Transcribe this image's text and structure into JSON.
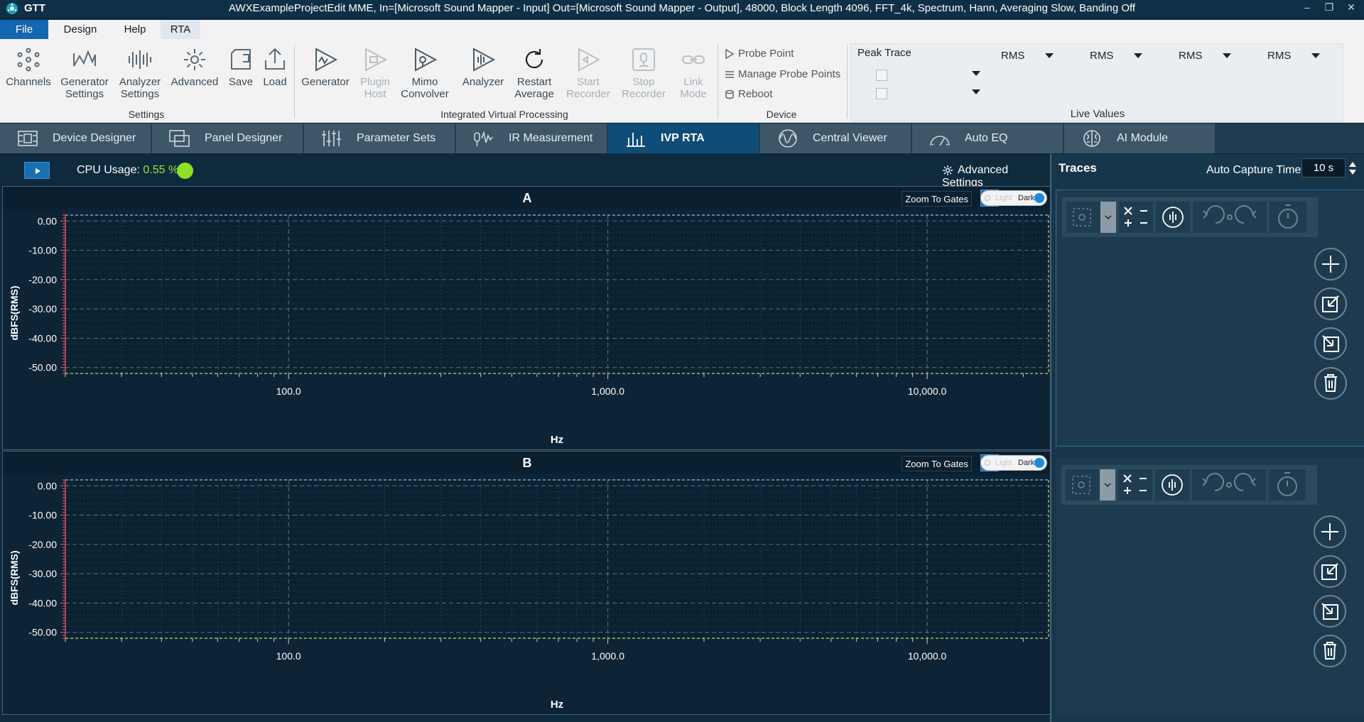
{
  "app": {
    "name": "GTT",
    "window_title": "AWXExampleProjectEdit MME, In=[Microsoft Sound Mapper - Input] Out=[Microsoft Sound Mapper - Output], 48000, Block Length 4096, FFT_4k, Spectrum, Hann, Averaging Slow, Banding Off",
    "controls": [
      "–",
      "❐",
      "✕"
    ]
  },
  "menu": [
    "File",
    "Design",
    "Help",
    "RTA"
  ],
  "ribbon": {
    "settings_group": {
      "label": "Settings",
      "buttons": [
        "Channels",
        "Generator Settings",
        "Analyzer Settings",
        "Advanced",
        "Save",
        "Load"
      ]
    },
    "ivp_group": {
      "label": "Integrated Virtual Processing",
      "buttons": [
        {
          "label": "Generator",
          "enabled": true
        },
        {
          "label": "Plugin Host",
          "enabled": false
        },
        {
          "label": "Mimo Convolver",
          "enabled": true
        },
        {
          "label": "Analyzer",
          "enabled": true
        },
        {
          "label": "Restart Average",
          "enabled": true
        },
        {
          "label": "Start Recorder",
          "enabled": false
        },
        {
          "label": "Stop Recorder",
          "enabled": false
        },
        {
          "label": "Link Mode",
          "enabled": false
        }
      ]
    },
    "device_group": {
      "label": "Device",
      "items": [
        "Probe Point",
        "Manage Probe Points",
        "Reboot"
      ]
    },
    "live_values": {
      "label": "Live Values",
      "peak_trace": "Peak Trace",
      "rms": [
        "RMS",
        "RMS",
        "RMS",
        "RMS"
      ]
    }
  },
  "tabs": [
    {
      "label": "Device Designer",
      "active": false
    },
    {
      "label": "Panel Designer",
      "active": false
    },
    {
      "label": "Parameter Sets",
      "active": false
    },
    {
      "label": "IR Measurement",
      "active": false
    },
    {
      "label": "IVP RTA",
      "active": true
    },
    {
      "label": "Central Viewer",
      "active": false
    },
    {
      "label": "Auto EQ",
      "active": false
    },
    {
      "label": "AI Module",
      "active": false
    }
  ],
  "toolbar": {
    "cpu_label": "CPU Usage:",
    "cpu_value": "0.55 %",
    "advanced_settings": "Advanced Settings"
  },
  "plots": [
    {
      "title": "A",
      "zoom_to_gates": "Zoom To Gates",
      "toggle_light": "Light",
      "toggle_dark": "Dark"
    },
    {
      "title": "B",
      "zoom_to_gates": "Zoom To Gates",
      "toggle_light": "Light",
      "toggle_dark": "Dark"
    }
  ],
  "chart_data": {
    "type": "line",
    "ylabel": "dBFS(RMS)",
    "xlabel": "Hz",
    "x_scale": "log",
    "xlim": [
      20,
      24000
    ],
    "ylim": [
      -52,
      2
    ],
    "ytick_labels": [
      "0.00",
      "-10.00",
      "-20.00",
      "-30.00",
      "-40.00",
      "-50.00"
    ],
    "ytick_values": [
      0,
      -10,
      -20,
      -30,
      -40,
      -50
    ],
    "xtick_labels": [
      "100.0",
      "1,000.0",
      "10,000.0"
    ],
    "xtick_values": [
      100,
      1000,
      10000
    ],
    "series": [],
    "grid": true
  },
  "traces": {
    "title": "Traces",
    "auto_capture_label": "Auto Capture Time",
    "auto_capture_value": "10 s"
  },
  "colors": {
    "accent": "#1466b0",
    "plot_bg": "#0d2436",
    "cpu_ok": "#8fe021"
  }
}
